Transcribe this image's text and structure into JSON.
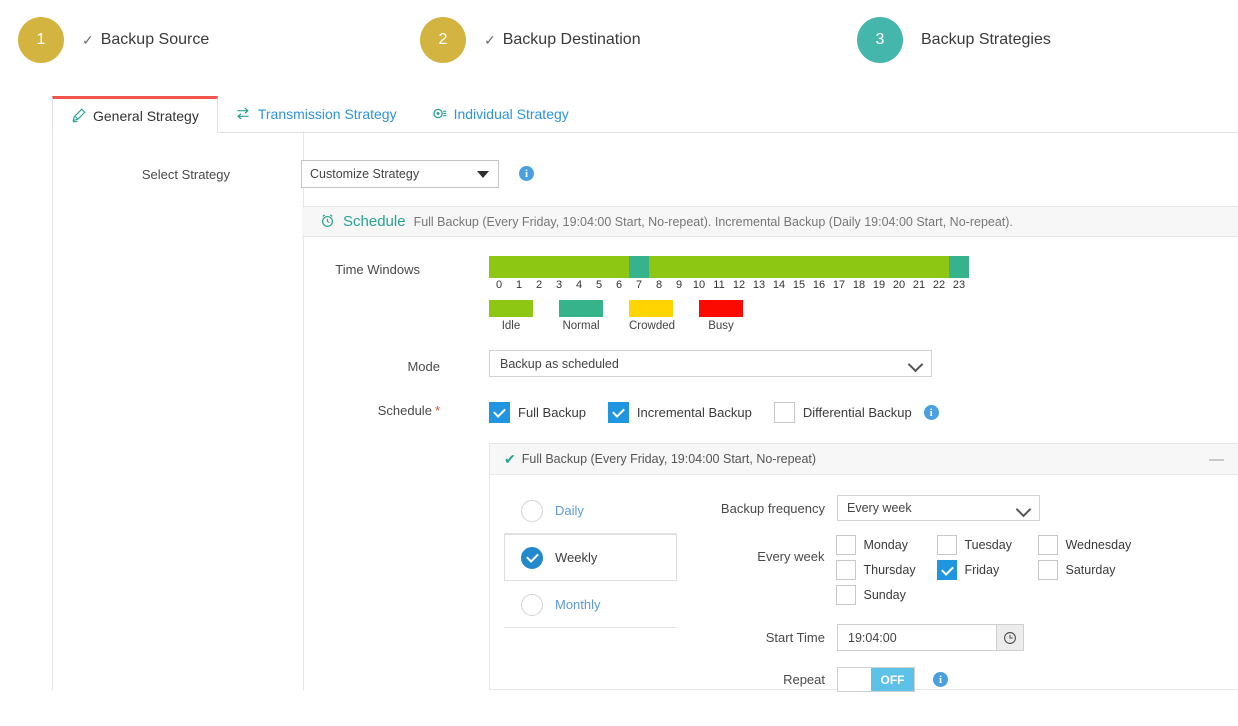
{
  "steps": [
    {
      "num": "1",
      "label": "Backup Source",
      "done": true,
      "color": "#d4b441"
    },
    {
      "num": "2",
      "label": "Backup Destination",
      "done": true,
      "color": "#d4b441"
    },
    {
      "num": "3",
      "label": "Backup Strategies",
      "done": false,
      "color": "#45b6ab"
    }
  ],
  "tabs": [
    {
      "label": "General Strategy",
      "icon": "pencil-icon",
      "active": true
    },
    {
      "label": "Transmission Strategy",
      "icon": "transfer-icon",
      "active": false
    },
    {
      "label": "Individual Strategy",
      "icon": "settings-gear-icon",
      "active": false
    }
  ],
  "select_strategy": {
    "label": "Select Strategy",
    "value": "Customize Strategy",
    "info": "i"
  },
  "schedule_banner": {
    "title": "Schedule",
    "description": "Full Backup (Every Friday, 19:04:00 Start, No-repeat). Incremental Backup (Daily 19:04:00 Start, No-repeat)."
  },
  "time_windows": {
    "label": "Time Windows",
    "hours": [
      "0",
      "1",
      "2",
      "3",
      "4",
      "5",
      "6",
      "7",
      "8",
      "9",
      "10",
      "11",
      "12",
      "13",
      "14",
      "15",
      "16",
      "17",
      "18",
      "19",
      "20",
      "21",
      "22",
      "23"
    ],
    "segments": [
      {
        "from": 0,
        "to": 7,
        "state": "Idle",
        "color": "#8dc714"
      },
      {
        "from": 7,
        "to": 8,
        "state": "Normal",
        "color": "#36b38a"
      },
      {
        "from": 8,
        "to": 23,
        "state": "Idle",
        "color": "#8dc714"
      },
      {
        "from": 23,
        "to": 24,
        "state": "Normal",
        "color": "#36b38a"
      }
    ],
    "legend": [
      {
        "label": "Idle",
        "color": "#8dc714"
      },
      {
        "label": "Normal",
        "color": "#36b38a"
      },
      {
        "label": "Crowded",
        "color": "#ffd400"
      },
      {
        "label": "Busy",
        "color": "#fa0a00"
      }
    ]
  },
  "mode": {
    "label": "Mode",
    "value": "Backup as scheduled"
  },
  "schedule_types": {
    "label": "Schedule",
    "required_mark": "*",
    "options": [
      {
        "label": "Full Backup",
        "checked": true
      },
      {
        "label": "Incremental Backup",
        "checked": true
      },
      {
        "label": "Differential Backup",
        "checked": false
      }
    ],
    "info": "i"
  },
  "full_backup_panel": {
    "header": "Full Backup (Every Friday, 19:04:00 Start, No-repeat)",
    "collapse_icon": "—",
    "frequency_options": [
      {
        "label": "Daily",
        "selected": false
      },
      {
        "label": "Weekly",
        "selected": true
      },
      {
        "label": "Monthly",
        "selected": false
      }
    ],
    "backup_frequency": {
      "label": "Backup frequency",
      "value": "Every week"
    },
    "every_week": {
      "label": "Every week",
      "days": [
        {
          "label": "Monday",
          "checked": false
        },
        {
          "label": "Tuesday",
          "checked": false
        },
        {
          "label": "Wednesday",
          "checked": false
        },
        {
          "label": "Thursday",
          "checked": false
        },
        {
          "label": "Friday",
          "checked": true
        },
        {
          "label": "Saturday",
          "checked": false
        },
        {
          "label": "Sunday",
          "checked": false
        }
      ]
    },
    "start_time": {
      "label": "Start Time",
      "value": "19:04:00",
      "picker_icon": "clock-icon"
    },
    "repeat": {
      "label": "Repeat",
      "state": "OFF",
      "info": "i"
    }
  }
}
